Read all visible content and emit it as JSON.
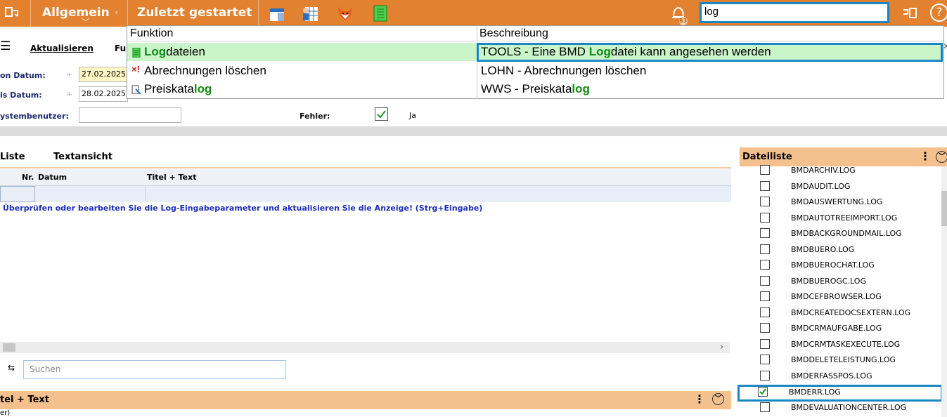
{
  "topbar": {
    "menu_general": "Allgemein",
    "recent_label": "Zuletzt gestartet",
    "notification_count": "83",
    "search_value": "log",
    "help_symbol": "?"
  },
  "dropdown": {
    "col_function": "Funktion",
    "col_description": "Beschreibung",
    "rows": [
      {
        "func_pre": "",
        "func_hl": "Log",
        "func_post": "dateien",
        "desc_pre": "TOOLS - Eine BMD ",
        "desc_hl": "Log",
        "desc_post": "datei kann angesehen werden"
      },
      {
        "func_pre": "Abrechnungen löschen",
        "func_hl": "",
        "func_post": "",
        "desc_pre": "LOHN - Abrechnungen löschen",
        "desc_hl": "",
        "desc_post": ""
      },
      {
        "func_pre": "Preiskata",
        "func_hl": "log",
        "func_post": "",
        "desc_pre": "WWS - Preiskata",
        "desc_hl": "log",
        "desc_post": ""
      }
    ]
  },
  "toolbar": {
    "refresh_label": "Aktualisieren",
    "fu_label": "Fu"
  },
  "form": {
    "from_label": "on Datum:",
    "from_value": "27.02.2025",
    "to_label": "is Datum:",
    "to_value": "28.02.2025",
    "user_label": "ystembenutzer:",
    "error_label": "Fehler:",
    "error_value": "Ja"
  },
  "tabs": {
    "list": "Liste",
    "text": "Textansicht"
  },
  "grid": {
    "col_nr": "Nr.",
    "col_date": "Datum",
    "col_title": "Titel + Text",
    "notice": "Überprüfen oder bearbeiten Sie die Log-Eingabeparameter und aktualisieren Sie die Anzeige! (Strg+Eingabe)"
  },
  "search": {
    "placeholder": "Suchen"
  },
  "bottom_panel": {
    "title": "tel + Text",
    "snippet": "er)"
  },
  "filelist": {
    "title": "Dateiliste",
    "items": [
      {
        "name": "BMDARCHIV.LOG",
        "checked": false
      },
      {
        "name": "BMDAUDIT.LOG",
        "checked": false
      },
      {
        "name": "BMDAUSWERTUNG.LOG",
        "checked": false
      },
      {
        "name": "BMDAUTOTREEIMPORT.LOG",
        "checked": false
      },
      {
        "name": "BMDBACKGROUNDMAIL.LOG",
        "checked": false
      },
      {
        "name": "BMDBUERO.LOG",
        "checked": false
      },
      {
        "name": "BMDBUEROCHAT.LOG",
        "checked": false
      },
      {
        "name": "BMDBUEROGC.LOG",
        "checked": false
      },
      {
        "name": "BMDCEFBROWSER.LOG",
        "checked": false
      },
      {
        "name": "BMDCREATEDOCSEXTERN.LOG",
        "checked": false
      },
      {
        "name": "BMDCRMAUFGABE.LOG",
        "checked": false
      },
      {
        "name": "BMDCRMTASKEXECUTE.LOG",
        "checked": false
      },
      {
        "name": "BMDDELETELEISTUNG.LOG",
        "checked": false
      },
      {
        "name": "BMDERFASSPOS.LOG",
        "checked": false
      },
      {
        "name": "BMDERR.LOG",
        "checked": true
      },
      {
        "name": "BMDEVALUATIONCENTER.LOG",
        "checked": false
      }
    ]
  },
  "colors": {
    "accent": "#e2812f",
    "selection": "#1a86c6",
    "highlight": "#138a13"
  }
}
